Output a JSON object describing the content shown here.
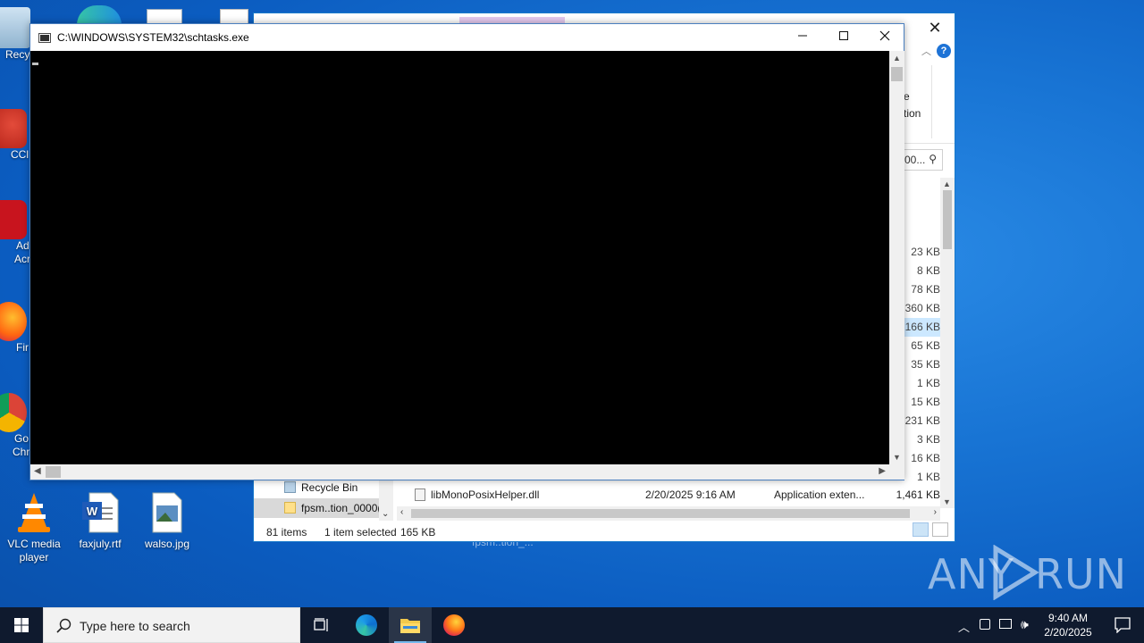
{
  "desktop": {
    "icons": [
      {
        "label": "VLC media player"
      },
      {
        "label": "faxjuly.rtf"
      },
      {
        "label": "walso.jpg"
      }
    ],
    "cut_icons": [
      {
        "label": "Recy"
      },
      {
        "label": "CCl"
      },
      {
        "label": "Ad"
      },
      {
        "label": "Acr"
      },
      {
        "label": "Fir"
      },
      {
        "label": "Go"
      },
      {
        "label": "Chr"
      }
    ],
    "ghost_label": "fpsm..tion_..."
  },
  "console": {
    "title": "C:\\WINDOWS\\SYSTEM32\\schtasks.exe",
    "minimize_icon": "minimize-icon",
    "maximize_icon": "maximize-icon",
    "close_icon": "close-icon"
  },
  "explorer": {
    "ribbon_partial_1": "e",
    "ribbon_partial_2": "tion",
    "search_partial": "00...",
    "sizes": [
      "23 KB",
      "8 KB",
      "78 KB",
      "360 KB",
      "166 KB",
      "65 KB",
      "35 KB",
      "1 KB",
      "15 KB",
      "231 KB",
      "3 KB",
      "16 KB",
      "1 KB"
    ],
    "selected_size_index": 4,
    "nav": [
      {
        "label": "Recycle Bin"
      },
      {
        "label": "fpsm..tion_0000("
      }
    ],
    "file": {
      "name": "libMonoPosixHelper.dll",
      "date": "2/20/2025 9:16 AM",
      "type": "Application exten...",
      "size": "1,461 KB"
    },
    "status": {
      "items": "81 items",
      "selected": "1 item selected",
      "size": "165 KB"
    }
  },
  "taskbar": {
    "search_placeholder": "Type here to search",
    "time": "9:40 AM",
    "date": "2/20/2025"
  },
  "watermark": {
    "left": "ANY",
    "right": "RUN"
  },
  "colors": {
    "desktop": "#0b5cc0",
    "taskbar": "#0f1a2e",
    "console_bg": "#000000",
    "accent": "#1e73d6"
  }
}
